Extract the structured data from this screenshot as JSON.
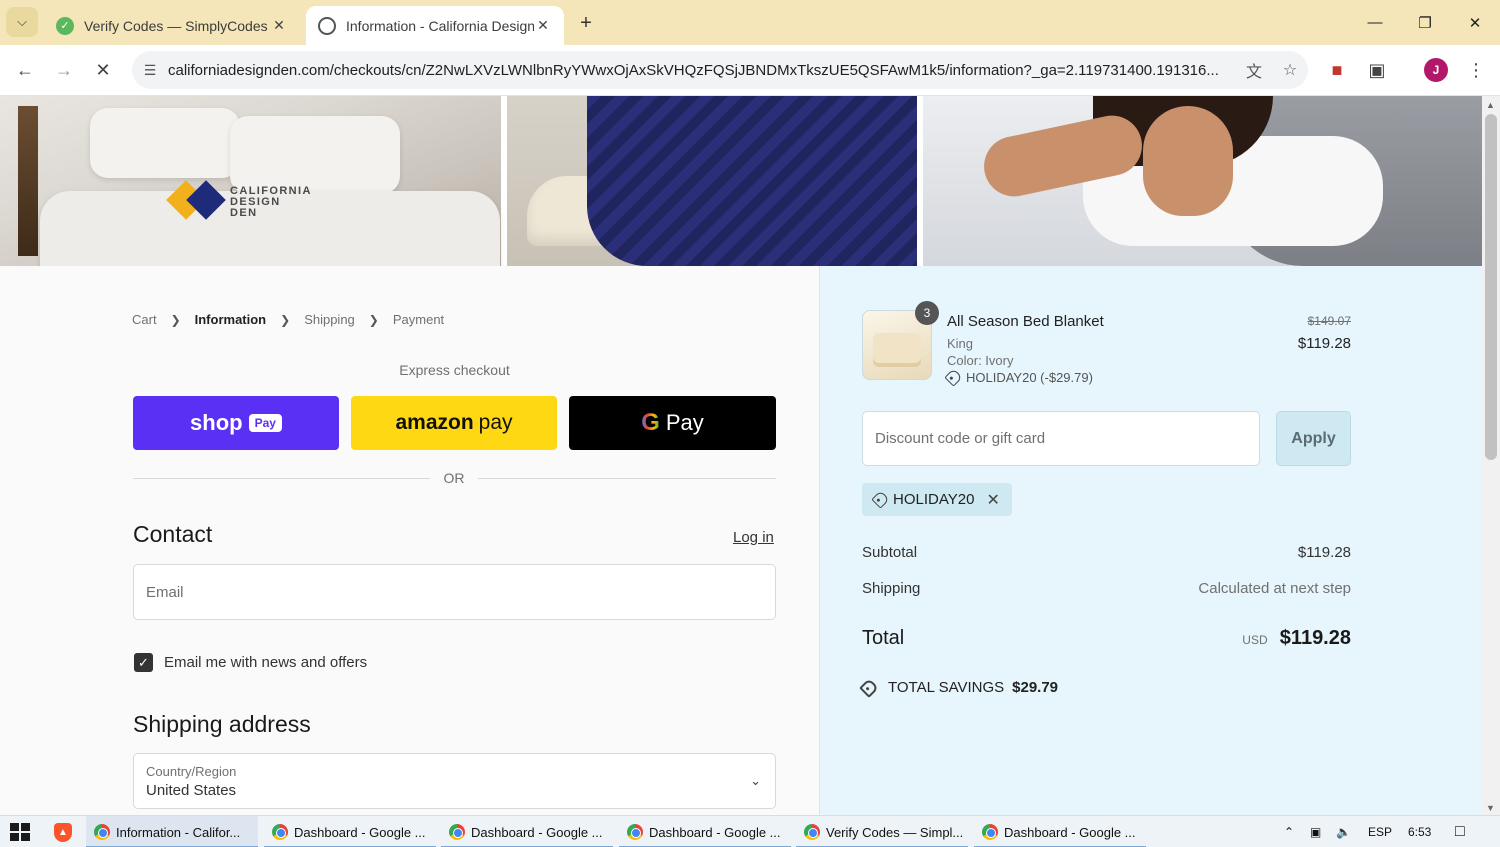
{
  "browser": {
    "tabs": [
      {
        "title": "Verify Codes — SimplyCodes",
        "active": false
      },
      {
        "title": "Information - California Design",
        "active": true
      }
    ],
    "new_tab_symbol": "+",
    "url": "californiadesignden.com/checkouts/cn/Z2NwLXVzLWNlbnRyYWwxOjAxSkVHQzFQSjJBNDMxTkszUE5QSFAwM1k5/information?_ga=2.119731400.191316...",
    "profile_initial": "J"
  },
  "brand": {
    "logo_lines": [
      "CALIFORNIA",
      "DESIGN",
      "DEN"
    ],
    "colors": {
      "yellow": "#f2b11c",
      "navy": "#1e2a7a"
    }
  },
  "breadcrumb": {
    "items": [
      "Cart",
      "Information",
      "Shipping",
      "Payment"
    ],
    "current_index": 1
  },
  "express": {
    "label": "Express checkout",
    "shop_pay": {
      "shop": "shop",
      "pay": "Pay"
    },
    "amazon_pay": {
      "amazon": "amazon",
      "pay": "pay"
    },
    "google_pay": {
      "g": "G",
      "pay": "Pay"
    },
    "or_label": "OR"
  },
  "contact": {
    "heading": "Contact",
    "login_link": "Log in",
    "email_placeholder": "Email",
    "email_value": "",
    "newsletter_label": "Email me with news and offers",
    "newsletter_checked": true
  },
  "shipping_address": {
    "heading": "Shipping address",
    "country_label": "Country/Region",
    "country_value": "United States"
  },
  "summary": {
    "item": {
      "quantity": "3",
      "name": "All Season Bed Blanket",
      "size": "King",
      "color": "Color: Ivory",
      "discount": "HOLIDAY20 (-$29.79)",
      "original_price": "$149.07",
      "price": "$119.28"
    },
    "discount_placeholder": "Discount code or gift card",
    "apply_label": "Apply",
    "applied_code": "HOLIDAY20",
    "subtotal_label": "Subtotal",
    "subtotal_value": "$119.28",
    "shipping_label": "Shipping",
    "shipping_value": "Calculated at next step",
    "total_label": "Total",
    "currency": "USD",
    "total_value": "$119.28",
    "savings_label": "TOTAL SAVINGS",
    "savings_value": "$29.79"
  },
  "taskbar": {
    "apps": [
      "Information - Califor...",
      "Dashboard - Google ...",
      "Dashboard - Google ...",
      "Dashboard - Google ...",
      "Verify Codes — Simpl...",
      "Dashboard - Google ..."
    ],
    "language": "ESP",
    "time": "6:53"
  }
}
